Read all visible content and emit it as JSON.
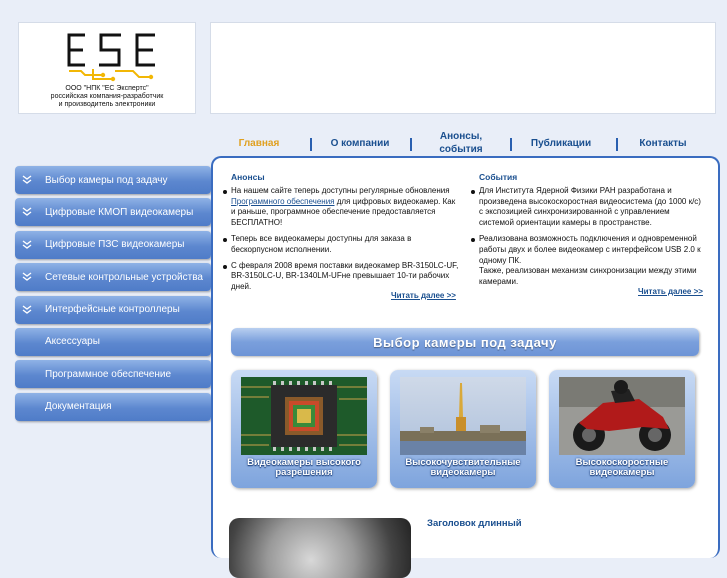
{
  "logo": {
    "mark": "ESE",
    "line1": "ООО \"НПК \"ЕС Экспертс\"",
    "line2": "российская компания-разработчик",
    "line3": "и производитель электроники"
  },
  "nav": {
    "items": [
      {
        "label": "Главная",
        "active": true
      },
      {
        "label": "О компании",
        "active": false
      },
      {
        "label": "Анонсы, события",
        "active": false
      },
      {
        "label": "Публикации",
        "active": false
      },
      {
        "label": "Контакты",
        "active": false
      }
    ]
  },
  "sidebar": {
    "items": [
      {
        "label": "Выбор камеры под задачу"
      },
      {
        "label": "Цифровые КМОП видеокамеры"
      },
      {
        "label": "Цифровые ПЗС видеокамеры"
      },
      {
        "label": "Сетевые контрольные устройства"
      },
      {
        "label": "Интерфейсные контроллеры"
      },
      {
        "label": "Аксессуары"
      },
      {
        "label": "Программное обеспечение"
      },
      {
        "label": "Документация"
      }
    ]
  },
  "announcements": {
    "title": "Анонсы",
    "item1_pre": "На нашем сайте теперь доступны регулярные обновления ",
    "item1_link": "Программного обеспечения",
    "item1_post": " для цифровых видеокамер. Как и раньше, программное обеспечение предоставляется БЕСПЛАТНО!",
    "item2": "Теперь все видеокамеры доступны для заказа в бескорпусном исполнении.",
    "item3": "С февраля   2008 время поставки видеокамер  BR-3150LC-UF,  BR-3150LC-U,  BR-1340LM-UFне превышает 10-ти рабочих дней.",
    "more": "Читать далее >>"
  },
  "events": {
    "title": "События",
    "item1": "Для Института Ядерной Физики РАН разработана и произведена высокоскоростная  видеосистема (до 1000 к/с) с экспозицией синхронизированной с управлением системой ориентации камеры в пространстве.",
    "item2": "Реализована возможность подключения и одновременной работы двух и более видеокамер           с интерфейсом USB 2.0 к одному ПК.",
    "item2b": "Также, реализован механизм синхронизации между этими камерами.",
    "more": "Читать далее >>"
  },
  "section": {
    "title": "Выбор камеры под задачу"
  },
  "cards": [
    {
      "caption": "Видеокамеры высокого разрешения"
    },
    {
      "caption": "Высокочувствительные видеокамеры"
    },
    {
      "caption": "Высокоскоростные видеокамеры"
    }
  ],
  "article": {
    "headline": "Заголовок длинный"
  },
  "colors": {
    "accent": "#1a4f8f",
    "active": "#e0a020",
    "border": "#3a6cc0"
  }
}
